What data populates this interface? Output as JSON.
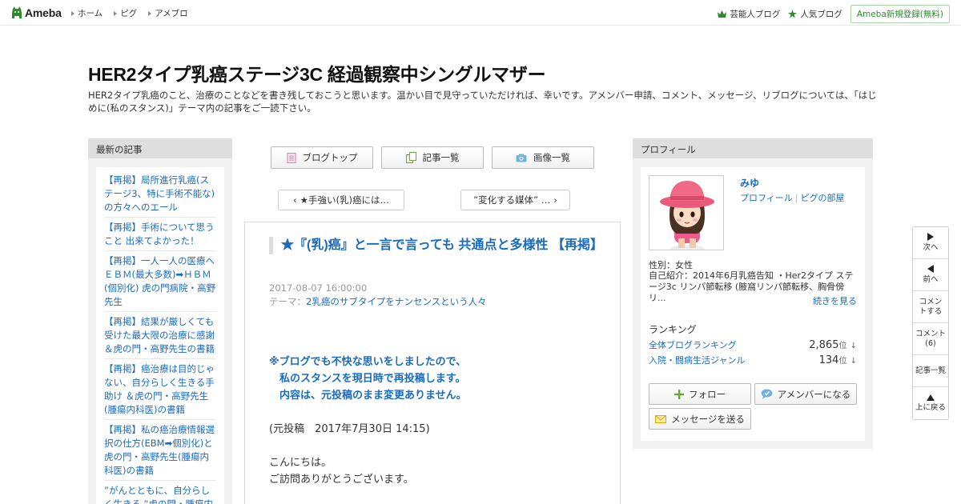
{
  "topbar": {
    "logo_text": "Ameba",
    "nav": [
      "ホーム",
      "ピグ",
      "アメブロ"
    ],
    "right_links": [
      {
        "label": "芸能人ブログ",
        "icon": "crown-icon"
      },
      {
        "label": "人気ブログ",
        "icon": "star-icon"
      }
    ],
    "register": "Ameba新規登録(無料)"
  },
  "blog": {
    "title": "HER2タイプ乳癌ステージ3C 経過観察中シングルマザー",
    "description": "HER2タイプ乳癌のこと、治療のことなどを書き残しておこうと思います。温かい目で見守っていただければ、幸いです。アメンバー申請、コメント、メッセージ、リブログについては、「はじめに(私のスタンス)」テーマ内の記事をご一読下さい。"
  },
  "left": {
    "heading": "最新の記事",
    "items": [
      "【再掲】局所進行乳癌(ステージ3、特に手術不能な)の方々へのエール",
      "【再掲】手術について思うこと 出来てよかった！",
      "【再掲】一人一人の医療へ ＥＢＭ(最大多数)➡ＨＢＭ(個別化) 虎の門病院・高野先生",
      "【再掲】結果が厳しくても受けた最大限の治療に感謝 ＆虎の門・高野先生の書籍",
      "【再掲】癌治療は目的じゃない、自分らしく生きる手助け ＆虎の門・高野先生(腫瘍内科医)の書籍",
      "【再掲】私の癌治療情報選択の仕方(EBM➡個別化)と虎の門・高野先生(腫瘍内科医)の書籍",
      "”がんとともに、自分らしく生きる ”虎の門・腫瘍内"
    ]
  },
  "center": {
    "tabs": [
      {
        "label": "ブログトップ",
        "icon": "document-icon"
      },
      {
        "label": "記事一覧",
        "icon": "copy-icon"
      },
      {
        "label": "画像一覧",
        "icon": "camera-icon"
      }
    ],
    "prev_post": "★手強い(乳)癌には…",
    "next_post": "”変化する媒体” …",
    "entry": {
      "title": "★『(乳)癌』と一言で言っても 共通点と多様性 【再掲】",
      "date": "2017-08-07 16:00:00",
      "theme_label": "テーマ：",
      "theme": "2乳癌のサブタイプをナンセンスという人々",
      "notice": [
        "※ブログでも不快な思いをしましたので、",
        "　私のスタンスを現日時で再投稿します。",
        "　内容は、元投稿のまま変更ありません。"
      ],
      "original": "(元投稿　2017年7月30日 14:15)",
      "greeting": [
        "こんにちは。",
        "ご訪問ありがとうございます。"
      ]
    }
  },
  "right": {
    "heading": "プロフィール",
    "name": "みゆ",
    "links": [
      "プロフィール",
      "ピグの部屋"
    ],
    "gender": "性別：女性",
    "intro": "自己紹介：2014年6月乳癌告知 ・Her2タイプ ステージ3c リンパ節転移 (腋窩リンパ節転移、胸骨傍リ...",
    "more": "続きを見る",
    "ranking_heading": "ランキング",
    "rankings": [
      {
        "label": "全体ブログランキング",
        "value": "2,865",
        "unit": "位",
        "arrow": "↓"
      },
      {
        "label": "入院・闘病生活ジャンル",
        "value": "134",
        "unit": "位",
        "arrow": "↓"
      }
    ],
    "buttons": {
      "follow": "フォロー",
      "amember": "アメンバーになる",
      "message": "メッセージを送る"
    }
  },
  "side_nav": {
    "next": "次へ",
    "prev": "前へ",
    "comment": "コメントする",
    "comment_count_label": "コメント",
    "comment_count": "(6)",
    "list": "記事一覧",
    "top": "上に戻る"
  },
  "colors": {
    "link": "#1a6bbf",
    "brand_green": "#2d8a2d"
  }
}
